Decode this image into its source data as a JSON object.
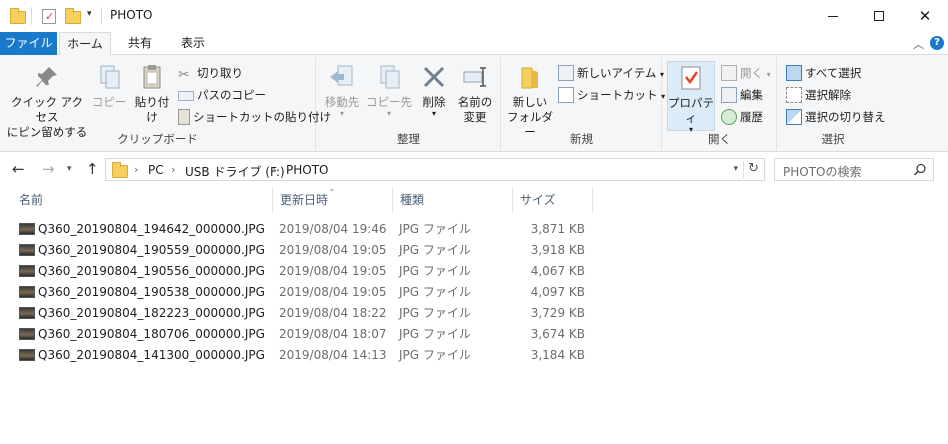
{
  "window": {
    "title": "PHOTO",
    "minimize_icon": "minimize-icon",
    "maximize_icon": "maximize-icon",
    "close_icon": "close-icon"
  },
  "tabs": [
    {
      "label": "ファイル"
    },
    {
      "label": "ホーム"
    },
    {
      "label": "共有"
    },
    {
      "label": "表示"
    }
  ],
  "ribbon": {
    "clipboard": {
      "label": "クリップボード",
      "pin_line1": "クイック アクセス",
      "pin_line2": "にピン留めする",
      "copy": "コピー",
      "paste": "貼り付け",
      "cut": "切り取り",
      "copy_path": "パスのコピー",
      "paste_shortcut": "ショートカットの貼り付け"
    },
    "organize": {
      "label": "整理",
      "move_to": "移動先",
      "copy_to": "コピー先",
      "delete": "削除",
      "rename_line1": "名前の",
      "rename_line2": "変更"
    },
    "new": {
      "label": "新規",
      "new_folder_line1": "新しい",
      "new_folder_line2": "フォルダー",
      "new_item": "新しいアイテム",
      "easy_access": "ショートカット"
    },
    "open": {
      "label": "開く",
      "properties": "プロパティ",
      "open": "開く",
      "edit": "編集",
      "history": "履歴"
    },
    "select": {
      "label": "選択",
      "select_all": "すべて選択",
      "select_none": "選択解除",
      "invert": "選択の切り替え"
    }
  },
  "address": {
    "crumbs": [
      "PC",
      "USB ドライブ (F:)",
      "PHOTO"
    ],
    "search_placeholder": "PHOTOの検索"
  },
  "columns": {
    "name": "名前",
    "date": "更新日時",
    "type": "種類",
    "size": "サイズ"
  },
  "files": [
    {
      "name": "Q360_20190804_194642_000000.JPG",
      "date": "2019/08/04 19:46",
      "type": "JPG ファイル",
      "size": "3,871 KB"
    },
    {
      "name": "Q360_20190804_190559_000000.JPG",
      "date": "2019/08/04 19:05",
      "type": "JPG ファイル",
      "size": "3,918 KB"
    },
    {
      "name": "Q360_20190804_190556_000000.JPG",
      "date": "2019/08/04 19:05",
      "type": "JPG ファイル",
      "size": "4,067 KB"
    },
    {
      "name": "Q360_20190804_190538_000000.JPG",
      "date": "2019/08/04 19:05",
      "type": "JPG ファイル",
      "size": "4,097 KB"
    },
    {
      "name": "Q360_20190804_182223_000000.JPG",
      "date": "2019/08/04 18:22",
      "type": "JPG ファイル",
      "size": "3,729 KB"
    },
    {
      "name": "Q360_20190804_180706_000000.JPG",
      "date": "2019/08/04 18:07",
      "type": "JPG ファイル",
      "size": "3,674 KB"
    },
    {
      "name": "Q360_20190804_141300_000000.JPG",
      "date": "2019/08/04 14:13",
      "type": "JPG ファイル",
      "size": "3,184 KB"
    }
  ]
}
